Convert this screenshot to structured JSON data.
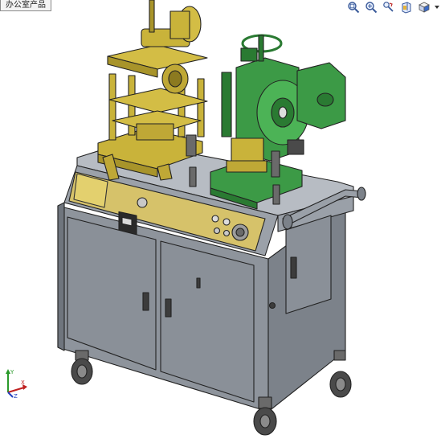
{
  "window": {
    "tab_title": "办公室产品"
  },
  "toolbar": {
    "buttons": [
      {
        "icon": "zoom-to-fit-icon"
      },
      {
        "icon": "zoom-area-icon"
      },
      {
        "icon": "previous-view-icon"
      },
      {
        "icon": "section-view-icon"
      },
      {
        "icon": "view-orientation-icon"
      }
    ]
  },
  "colors": {
    "machine_yellow": "#C9B33A",
    "press_green": "#3C9A46",
    "cabinet_gray": "#8E949C",
    "panel_yellow": "#D6C26A",
    "wheel_dark": "#4A4A4A"
  },
  "triad": {
    "axis_x": "X",
    "axis_y": "Y",
    "axis_z": "Z"
  }
}
